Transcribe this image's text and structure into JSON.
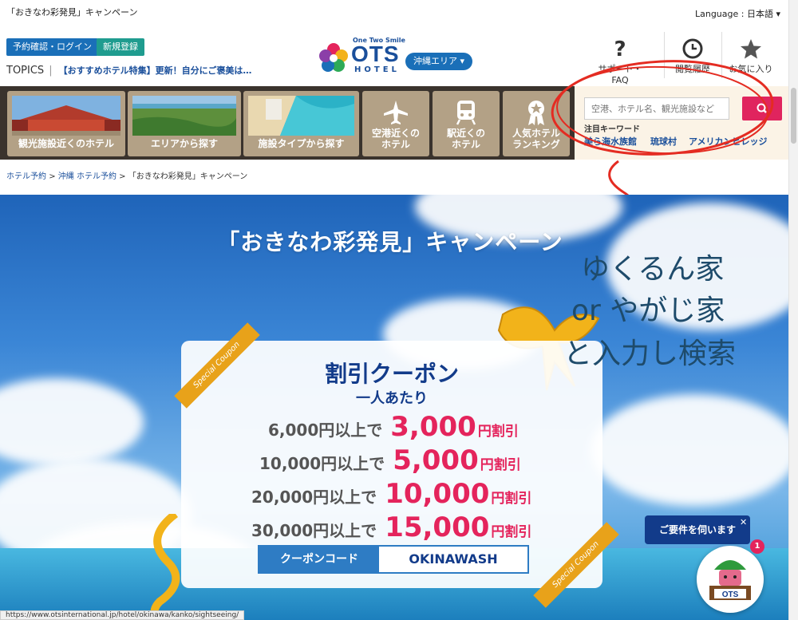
{
  "tab_title": "「おきなわ彩発見」キャンペーン",
  "language": "Language : 日本語 ▾",
  "header": {
    "login_label": "予約確認・ログイン",
    "register_label": "新規登録",
    "topics_label": "TOPICS",
    "topics_sep": "|",
    "topics_link": "【おすすめホテル特集】更新！自分にご褒美は…",
    "logo_tagline": "One Two Smile",
    "logo_text": "OTS",
    "logo_sub": "HOTEL",
    "area_button": "沖縄エリア ▾",
    "support_label": "サポート・FAQ",
    "history_label": "閲覧履歴",
    "favorites_label": "お気に入り"
  },
  "categories": [
    {
      "label": "観光施設近くのホテル",
      "icon": "photo-shuri-castle"
    },
    {
      "label": "エリアから探す",
      "icon": "photo-coast"
    },
    {
      "label": "施設タイプから探す",
      "icon": "photo-resort-beach"
    },
    {
      "label": "空港近くの\nホテル",
      "icon": "airplane-icon"
    },
    {
      "label": "駅近くの\nホテル",
      "icon": "train-icon"
    },
    {
      "label": "人気ホテル\nランキング",
      "icon": "medal-icon"
    }
  ],
  "search": {
    "placeholder": "空港、ホテル名、観光施設など",
    "keywords_title": "注目キーワード",
    "keywords": [
      "美ら海水族館",
      "琉球村",
      "アメリカンビレッジ"
    ]
  },
  "breadcrumb": {
    "items": [
      "ホテル予約",
      "沖縄 ホテル予約",
      "「おきなわ彩発見」キャンペーン"
    ],
    "separator": ">"
  },
  "hero": {
    "title": "「おきなわ彩発見」キャンペーン",
    "ribbon_text": "Special Coupon",
    "coupon_title": "割引クーポン",
    "coupon_sub": "一人あたり",
    "rows": [
      {
        "threshold": "6,000円以上で",
        "amount": "3,000",
        "unit": "円割引"
      },
      {
        "threshold": "10,000円以上で",
        "amount": "5,000",
        "unit": "円割引"
      },
      {
        "threshold": "20,000円以上で",
        "amount": "10,000",
        "unit": "円割引"
      },
      {
        "threshold": "30,000円以上で",
        "amount": "15,000",
        "unit": "円割引"
      }
    ],
    "code_label": "クーポンコード",
    "code_value": "OKINAWASH"
  },
  "annotation": {
    "line1": "ゆくるん家",
    "line2": "or  やがじ家",
    "line3": "と入力し検索",
    "color": "#1e4b6b",
    "mark_color": "#e42c22"
  },
  "chat": {
    "label": "ご要件を伺います",
    "close": "✕",
    "badge": "1",
    "avatar_text": "OTS"
  },
  "status_url": "https://www.otsinternational.jp/hotel/okinawa/kanko/sightseeing/"
}
